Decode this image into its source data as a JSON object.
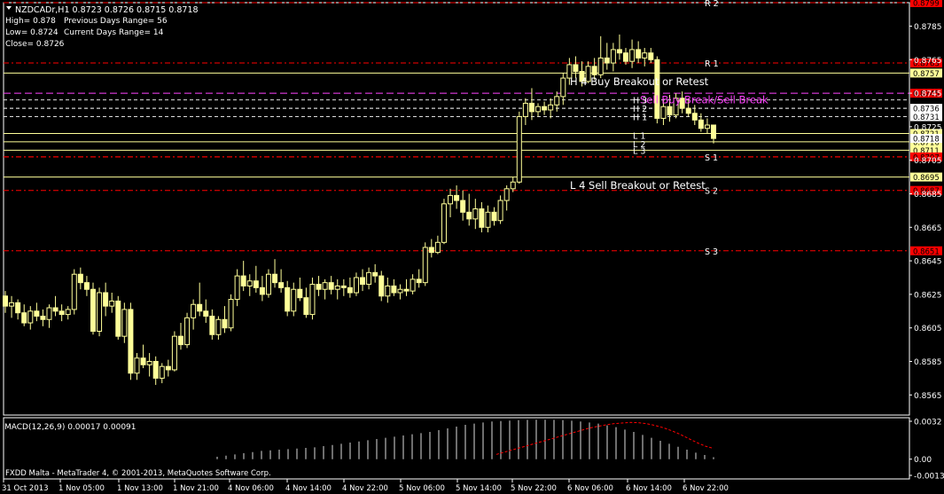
{
  "header": {
    "symbol_line": "NZDCADr,H1  0.8723 0.8726 0.8715 0.8718",
    "stats": [
      {
        "label": "High= 0.878",
        "extra": "Previous Days Range= 56"
      },
      {
        "label": "Low= 0.8724",
        "extra": "Current Days Range= 14"
      },
      {
        "label": "Close= 0.8726",
        "extra": ""
      }
    ]
  },
  "footer": {
    "copyright": "FXDD Malta - MetaTrader 4, © 2001-2013, MetaQuotes Software Corp."
  },
  "macd": {
    "label": "MACD(12,26,9) 0.00017 0.00091",
    "ticks": [
      "0.0032",
      "0.00",
      "-0.00137"
    ]
  },
  "colors": {
    "bg": "#000000",
    "grid": "#3a3a3a",
    "candle": "#FFFF99",
    "axis": "#FFFFFF",
    "pivot": "#FF0000",
    "level": "#FFFF99",
    "magenta": "#FF44FF"
  },
  "chart_data": {
    "type": "candlestick",
    "symbol": "NZDCADr",
    "timeframe": "H1",
    "ylim": [
      0.8553,
      0.8799
    ],
    "y_ticks": [
      "0.8785",
      "0.8765",
      "0.8745",
      "0.8725",
      "0.8705",
      "0.8685",
      "0.8665",
      "0.8645",
      "0.8625",
      "0.8605",
      "0.8585",
      "0.8565"
    ],
    "x_labels": [
      "31 Oct 2013",
      "1 Nov 05:00",
      "1 Nov 13:00",
      "1 Nov 21:00",
      "4 Nov 06:00",
      "4 Nov 14:00",
      "4 Nov 22:00",
      "5 Nov 06:00",
      "5 Nov 14:00",
      "5 Nov 22:00",
      "6 Nov 06:00",
      "6 Nov 14:00",
      "6 Nov 22:00"
    ],
    "candles": [
      [
        0.8624,
        0.8627,
        0.8614,
        0.8618
      ],
      [
        0.8618,
        0.8624,
        0.8611,
        0.862
      ],
      [
        0.862,
        0.8622,
        0.861,
        0.8614
      ],
      [
        0.8614,
        0.8619,
        0.8606,
        0.8608
      ],
      [
        0.8608,
        0.8618,
        0.8604,
        0.8615
      ],
      [
        0.8615,
        0.862,
        0.8609,
        0.8612
      ],
      [
        0.8612,
        0.8616,
        0.8606,
        0.861
      ],
      [
        0.861,
        0.8619,
        0.8605,
        0.8617
      ],
      [
        0.8617,
        0.8624,
        0.8612,
        0.8615
      ],
      [
        0.8615,
        0.8619,
        0.8609,
        0.8613
      ],
      [
        0.8613,
        0.8618,
        0.861,
        0.8616
      ],
      [
        0.8616,
        0.864,
        0.8613,
        0.8637
      ],
      [
        0.8637,
        0.8641,
        0.8628,
        0.8632
      ],
      [
        0.8632,
        0.8636,
        0.8624,
        0.8628
      ],
      [
        0.8628,
        0.8632,
        0.8601,
        0.8603
      ],
      [
        0.8603,
        0.8629,
        0.86,
        0.8626
      ],
      [
        0.8626,
        0.8632,
        0.8612,
        0.8618
      ],
      [
        0.8618,
        0.8626,
        0.8614,
        0.8621
      ],
      [
        0.8621,
        0.8624,
        0.8598,
        0.86
      ],
      [
        0.86,
        0.862,
        0.8596,
        0.8616
      ],
      [
        0.8616,
        0.862,
        0.8574,
        0.8578
      ],
      [
        0.8578,
        0.859,
        0.8574,
        0.8587
      ],
      [
        0.8587,
        0.8595,
        0.8581,
        0.8583
      ],
      [
        0.8583,
        0.859,
        0.8576,
        0.8585
      ],
      [
        0.8585,
        0.8588,
        0.8571,
        0.8575
      ],
      [
        0.8575,
        0.8584,
        0.8572,
        0.8582
      ],
      [
        0.8582,
        0.8586,
        0.8576,
        0.858
      ],
      [
        0.858,
        0.8603,
        0.8579,
        0.86
      ],
      [
        0.86,
        0.8608,
        0.8592,
        0.8595
      ],
      [
        0.8595,
        0.8614,
        0.8593,
        0.8611
      ],
      [
        0.8611,
        0.8622,
        0.8604,
        0.8619
      ],
      [
        0.8619,
        0.8632,
        0.8612,
        0.8615
      ],
      [
        0.8615,
        0.8622,
        0.8608,
        0.8612
      ],
      [
        0.8612,
        0.8616,
        0.8598,
        0.8601
      ],
      [
        0.8601,
        0.8612,
        0.8598,
        0.861
      ],
      [
        0.861,
        0.8618,
        0.8602,
        0.8605
      ],
      [
        0.8605,
        0.8625,
        0.8603,
        0.8622
      ],
      [
        0.8622,
        0.864,
        0.8618,
        0.8636
      ],
      [
        0.8636,
        0.8645,
        0.8627,
        0.863
      ],
      [
        0.863,
        0.8637,
        0.8624,
        0.8633
      ],
      [
        0.8633,
        0.8642,
        0.8626,
        0.8629
      ],
      [
        0.8629,
        0.8636,
        0.8621,
        0.8625
      ],
      [
        0.8625,
        0.864,
        0.8623,
        0.8637
      ],
      [
        0.8637,
        0.8646,
        0.8629,
        0.8632
      ],
      [
        0.8632,
        0.864,
        0.8626,
        0.8629
      ],
      [
        0.8629,
        0.8633,
        0.8612,
        0.8615
      ],
      [
        0.8615,
        0.8632,
        0.8612,
        0.8628
      ],
      [
        0.8628,
        0.8635,
        0.8621,
        0.8623
      ],
      [
        0.8623,
        0.8629,
        0.8611,
        0.8613
      ],
      [
        0.8613,
        0.8635,
        0.861,
        0.8631
      ],
      [
        0.8631,
        0.8636,
        0.8624,
        0.8628
      ],
      [
        0.8628,
        0.8634,
        0.8622,
        0.8632
      ],
      [
        0.8632,
        0.8636,
        0.8625,
        0.8628
      ],
      [
        0.8628,
        0.8634,
        0.8622,
        0.863
      ],
      [
        0.863,
        0.8634,
        0.8624,
        0.8629
      ],
      [
        0.8629,
        0.8635,
        0.8623,
        0.8626
      ],
      [
        0.8626,
        0.8638,
        0.8624,
        0.8635
      ],
      [
        0.8635,
        0.864,
        0.8627,
        0.8631
      ],
      [
        0.8631,
        0.8641,
        0.8628,
        0.8638
      ],
      [
        0.8638,
        0.8643,
        0.8632,
        0.8636
      ],
      [
        0.8636,
        0.8639,
        0.8621,
        0.8624
      ],
      [
        0.8624,
        0.8635,
        0.862,
        0.863
      ],
      [
        0.863,
        0.8634,
        0.8624,
        0.8626
      ],
      [
        0.8626,
        0.8631,
        0.8622,
        0.8628
      ],
      [
        0.8628,
        0.8634,
        0.8624,
        0.8627
      ],
      [
        0.8627,
        0.8637,
        0.8625,
        0.8634
      ],
      [
        0.8634,
        0.864,
        0.8629,
        0.8632
      ],
      [
        0.8632,
        0.8656,
        0.863,
        0.8653
      ],
      [
        0.8653,
        0.8658,
        0.8647,
        0.865
      ],
      [
        0.865,
        0.866,
        0.8649,
        0.8656
      ],
      [
        0.8656,
        0.8682,
        0.8655,
        0.8679
      ],
      [
        0.8679,
        0.8688,
        0.8671,
        0.8684
      ],
      [
        0.8684,
        0.869,
        0.8676,
        0.8681
      ],
      [
        0.8681,
        0.8687,
        0.8669,
        0.8674
      ],
      [
        0.8674,
        0.8685,
        0.8666,
        0.867
      ],
      [
        0.867,
        0.8682,
        0.8664,
        0.8676
      ],
      [
        0.8676,
        0.868,
        0.8662,
        0.8665
      ],
      [
        0.8665,
        0.8678,
        0.8662,
        0.8674
      ],
      [
        0.8674,
        0.8677,
        0.8666,
        0.8669
      ],
      [
        0.8669,
        0.8684,
        0.8667,
        0.8681
      ],
      [
        0.8681,
        0.869,
        0.8675,
        0.8688
      ],
      [
        0.8688,
        0.8695,
        0.8686,
        0.8692
      ],
      [
        0.8692,
        0.8734,
        0.8691,
        0.8731
      ],
      [
        0.8731,
        0.8742,
        0.8726,
        0.8739
      ],
      [
        0.8739,
        0.8748,
        0.8729,
        0.8734
      ],
      [
        0.8734,
        0.8739,
        0.8731,
        0.8737
      ],
      [
        0.8737,
        0.874,
        0.8732,
        0.8735
      ],
      [
        0.8735,
        0.8742,
        0.873,
        0.8738
      ],
      [
        0.8738,
        0.8746,
        0.8734,
        0.8743
      ],
      [
        0.8743,
        0.8757,
        0.8738,
        0.8754
      ],
      [
        0.8754,
        0.8766,
        0.875,
        0.8762
      ],
      [
        0.8762,
        0.8767,
        0.8754,
        0.8758
      ],
      [
        0.8758,
        0.8764,
        0.8749,
        0.8752
      ],
      [
        0.8752,
        0.8764,
        0.8751,
        0.8761
      ],
      [
        0.8761,
        0.8766,
        0.8753,
        0.8756
      ],
      [
        0.8756,
        0.8779,
        0.8754,
        0.8766
      ],
      [
        0.8766,
        0.8775,
        0.8759,
        0.8763
      ],
      [
        0.8763,
        0.8775,
        0.8758,
        0.8771
      ],
      [
        0.8771,
        0.878,
        0.8765,
        0.8769
      ],
      [
        0.8769,
        0.8772,
        0.8762,
        0.8764
      ],
      [
        0.8764,
        0.8777,
        0.876,
        0.8771
      ],
      [
        0.8771,
        0.8776,
        0.8763,
        0.8766
      ],
      [
        0.8766,
        0.8772,
        0.8761,
        0.8769
      ],
      [
        0.8769,
        0.8772,
        0.8763,
        0.8765
      ],
      [
        0.8765,
        0.8767,
        0.8727,
        0.873
      ],
      [
        0.873,
        0.8741,
        0.8726,
        0.8737
      ],
      [
        0.8737,
        0.8744,
        0.8728,
        0.8732
      ],
      [
        0.8732,
        0.8745,
        0.873,
        0.8742
      ],
      [
        0.8742,
        0.8746,
        0.8733,
        0.8736
      ],
      [
        0.8736,
        0.8742,
        0.8731,
        0.8733
      ],
      [
        0.8733,
        0.8738,
        0.8726,
        0.8729
      ],
      [
        0.8729,
        0.8733,
        0.8722,
        0.8724
      ],
      [
        0.8724,
        0.873,
        0.8721,
        0.8726
      ],
      [
        0.8726,
        0.8726,
        0.8715,
        0.8718
      ]
    ],
    "macd_hist": [
      0.0002,
      0.0003,
      0.0004,
      0.0005,
      0.0006,
      0.0007,
      0.00075,
      0.0008,
      0.00085,
      0.0009,
      0.00095,
      0.001,
      0.0011,
      0.0012,
      0.0013,
      0.0014,
      0.0015,
      0.0016,
      0.0017,
      0.0018,
      0.0019,
      0.002,
      0.0021,
      0.0022,
      0.0023,
      0.00245,
      0.0026,
      0.00275,
      0.0029,
      0.003,
      0.0031,
      0.00318,
      0.00322,
      0.00326,
      0.0033,
      0.00332,
      0.00333,
      0.00333,
      0.00332,
      0.0033,
      0.00325,
      0.00318,
      0.0031,
      0.003,
      0.00285,
      0.0027,
      0.0025,
      0.0023,
      0.00205,
      0.0018,
      0.00155,
      0.0013,
      0.00105,
      0.0008,
      0.00055,
      0.00035,
      0.00017
    ],
    "macd_signal": [
      0.0004,
      0.0006,
      0.0008,
      0.001,
      0.0012,
      0.0014,
      0.0016,
      0.0018,
      0.002,
      0.0022,
      0.0024,
      0.0026,
      0.00275,
      0.00288,
      0.003,
      0.00305,
      0.0031,
      0.00308,
      0.003,
      0.00285,
      0.00265,
      0.0024,
      0.0021,
      0.00175,
      0.0014,
      0.0011,
      0.00091
    ],
    "levels": [
      {
        "name": "R 2",
        "value": 0.8799,
        "label": "0.8799",
        "kind": "pivot"
      },
      {
        "name": "R 1",
        "value": 0.8763,
        "label": "0.8763",
        "kind": "pivot"
      },
      {
        "name": "H 4 Buy Breakout or Retest",
        "value": 0.8757,
        "label": "0.8757",
        "kind": "level"
      },
      {
        "name": "Sell Buy Break/Sell Break",
        "value": 0.8745,
        "label": "0.8745",
        "kind": "magenta"
      },
      {
        "name": "H 3",
        "value": 0.8741,
        "label": "",
        "kind": "dash"
      },
      {
        "name": "",
        "value": 0.8736,
        "label": "0.8736",
        "kind": "dash"
      },
      {
        "name": "H 2",
        "value": 0.8736,
        "label": "",
        "kind": "dash"
      },
      {
        "name": "",
        "value": 0.8731,
        "label": "0.8731",
        "kind": "dash"
      },
      {
        "name": "H 1",
        "value": 0.8731,
        "label": "",
        "kind": "dash"
      },
      {
        "name": "",
        "value": 0.8721,
        "label": "0.8721",
        "kind": "level"
      },
      {
        "name": "L 1",
        "value": 0.8716,
        "label": "0.8716",
        "kind": "level"
      },
      {
        "name": "L 2",
        "value": 0.8711,
        "label": "0.8711",
        "kind": "level"
      },
      {
        "name": "",
        "value": 0.8718,
        "label": "0.8718",
        "kind": "price"
      },
      {
        "name": "L 3",
        "value": 0.8707,
        "label": "0.8707",
        "kind": "pivot"
      },
      {
        "name": "S 1",
        "value": 0.8707,
        "label": "",
        "kind": "pivot"
      },
      {
        "name": "L 4 Sell Breakout or Retest",
        "value": 0.8695,
        "label": "0.8695",
        "kind": "level"
      },
      {
        "name": "S 2",
        "value": 0.8687,
        "label": "0.8687",
        "kind": "pivot"
      },
      {
        "name": "S 3",
        "value": 0.8651,
        "label": "0.8651",
        "kind": "pivot"
      }
    ]
  }
}
